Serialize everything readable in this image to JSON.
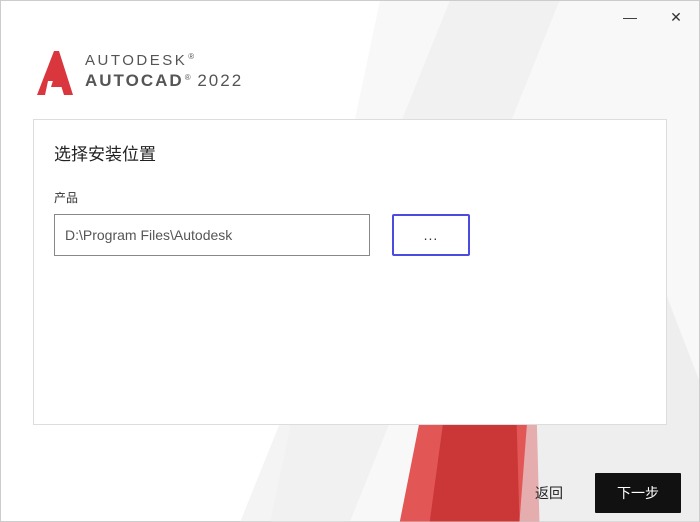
{
  "brand": {
    "line1": "AUTODESK",
    "product": "AUTOCAD",
    "year": "2022",
    "tm": "®"
  },
  "card": {
    "title": "选择安装位置",
    "product_label": "产品",
    "install_path": "D:\\Program Files\\Autodesk",
    "browse_label": "..."
  },
  "footer": {
    "back": "返回",
    "next": "下一步"
  },
  "window": {
    "minimize": "—",
    "close": "✕"
  }
}
